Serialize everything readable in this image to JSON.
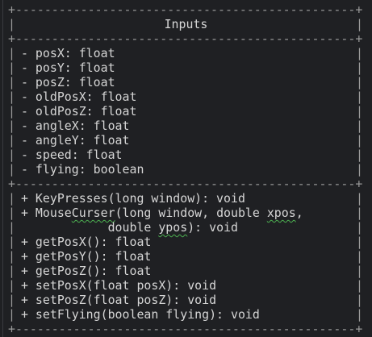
{
  "class_name": "Inputs",
  "attributes": [
    "- posX: float",
    "- posY: float",
    "- posZ: float",
    "- oldPosX: float",
    "- oldPosZ: float",
    "- angleX: float",
    "- angleY: float",
    "- speed: float",
    "- flying: boolean"
  ],
  "methods": [
    [
      {
        "t": "+ KeyPresses(long window): void"
      }
    ],
    [
      {
        "t": "+ Mouse"
      },
      {
        "t": "Curser",
        "sq": true
      },
      {
        "t": "(long window, double "
      },
      {
        "t": "xpos",
        "sq": true
      },
      {
        "t": ","
      }
    ],
    [
      {
        "t": "            double "
      },
      {
        "t": "ypos",
        "sq": true
      },
      {
        "t": "): void"
      }
    ],
    [
      {
        "t": "+ getPosX(): float"
      }
    ],
    [
      {
        "t": "+ getPosY(): float"
      }
    ],
    [
      {
        "t": "+ getPosZ(): float"
      }
    ],
    [
      {
        "t": "+ setPosX(float posX): void"
      }
    ],
    [
      {
        "t": "+ setPosZ(float posZ): void"
      }
    ],
    [
      {
        "t": "+ setFlying(boolean flying): void"
      }
    ]
  ],
  "colors": {
    "background": "#1f2023",
    "text": "#d6d6d6",
    "border": "#9a9a9a",
    "spellcheck": "#4caf50"
  }
}
